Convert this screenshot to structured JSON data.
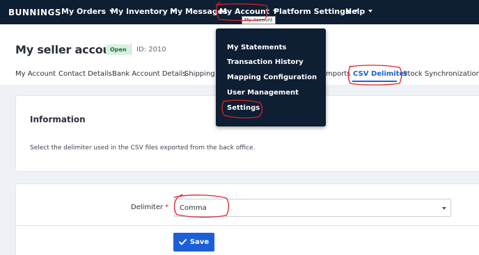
{
  "navbar": {
    "logo": "BUNNINGS",
    "items": [
      {
        "label": "My Orders",
        "has_caret": true
      },
      {
        "label": "My Inventory",
        "has_caret": true
      },
      {
        "label": "My Messages",
        "has_caret": false
      },
      {
        "label": "My Account",
        "has_caret": true
      },
      {
        "label": "Platform Settings",
        "has_caret": true
      },
      {
        "label": "Help",
        "has_caret": true
      }
    ],
    "tooltip": "My Account"
  },
  "account_menu": {
    "items": [
      "My Statements",
      "Transaction History",
      "Mapping Configuration",
      "User Management",
      "Settings"
    ]
  },
  "header": {
    "title": "My seller account",
    "status": "Open",
    "id_text": "ID: 2010"
  },
  "tabs": [
    {
      "label": "My Account",
      "active": false
    },
    {
      "label": "Contact Details",
      "active": false
    },
    {
      "label": "Bank Account Details",
      "active": false
    },
    {
      "label": "Shipping C",
      "active": false
    },
    {
      "label": "mports",
      "active": false
    },
    {
      "label": "CSV Delimiter",
      "active": true
    },
    {
      "label": "Stock Synchronization",
      "active": false
    }
  ],
  "info_section": {
    "title": "Information",
    "description": "Select the delimiter used in the CSV files exported from the back office."
  },
  "form": {
    "delimiter_label": "Delimiter",
    "required_mark": "*",
    "delimiter_value": "Comma",
    "save_label": "Save"
  },
  "icons": {
    "caret": "chevron-down-icon",
    "save": "check-icon"
  },
  "colors": {
    "navbar_bg": "#0e1e33",
    "accent": "#1d5fd8",
    "status_bg": "#d6f1de",
    "annotation": "#e0202a"
  }
}
